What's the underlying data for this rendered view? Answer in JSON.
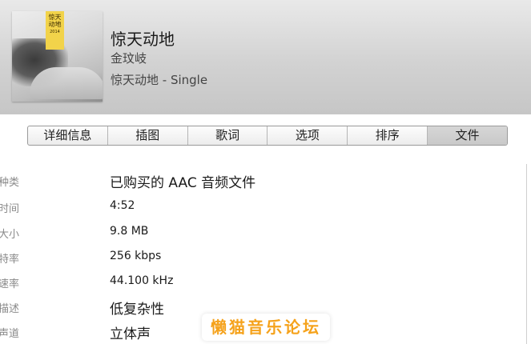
{
  "header": {
    "art_text": "惊天动地",
    "art_subtext": "2014",
    "title": "惊天动地",
    "artist": "金玟岐",
    "album": "惊天动地 - Single"
  },
  "tabs": [
    {
      "label": "详细信息",
      "active": false
    },
    {
      "label": "插图",
      "active": false
    },
    {
      "label": "歌词",
      "active": false
    },
    {
      "label": "选项",
      "active": false
    },
    {
      "label": "排序",
      "active": false
    },
    {
      "label": "文件",
      "active": true
    }
  ],
  "file_info": {
    "kind": {
      "label": "种类",
      "value": "已购买的 AAC 音频文件"
    },
    "duration": {
      "label": "持续时间",
      "value": "4:52"
    },
    "size": {
      "label": "大小",
      "value": "9.8 MB"
    },
    "bitrate": {
      "label": "比特率",
      "value": "256 kbps"
    },
    "sample_rate": {
      "label": "采样速率",
      "value": "44.100 kHz"
    },
    "profile": {
      "label": "描述",
      "value": "低复杂性"
    },
    "channels": {
      "label": "声道",
      "value": "立体声"
    }
  },
  "watermark": "懒猫音乐论坛",
  "colors": {
    "watermark": "#f5a21b",
    "label": "#8a8a8a"
  }
}
